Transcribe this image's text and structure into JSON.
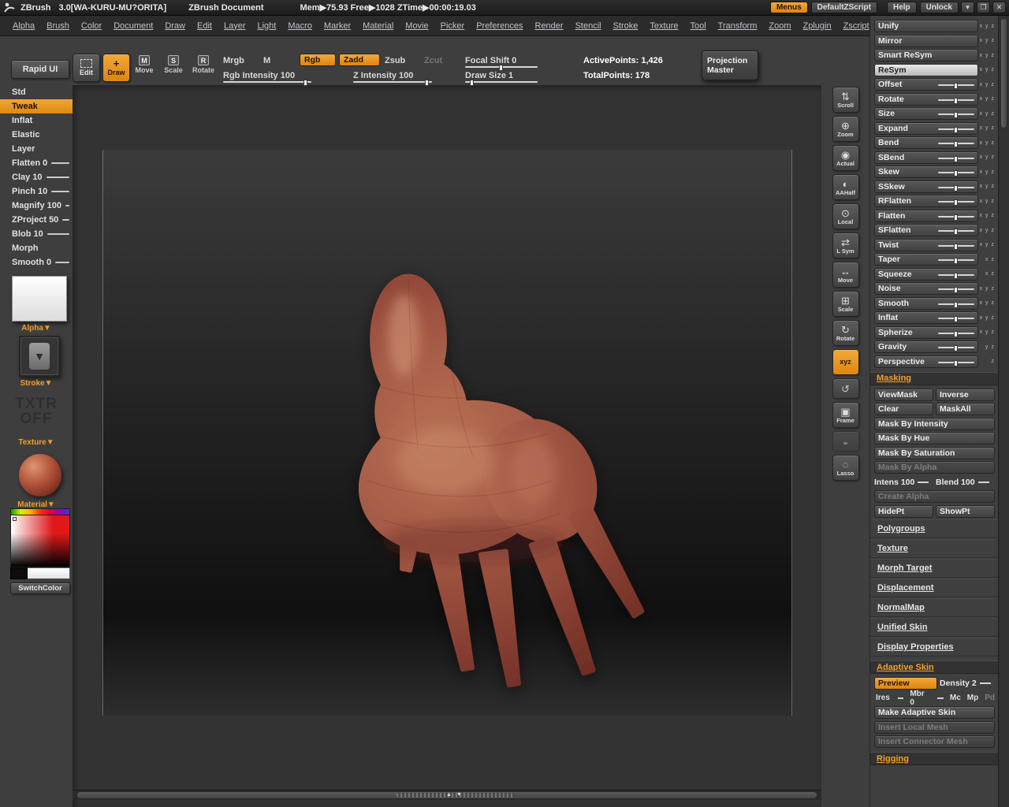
{
  "title_bar": {
    "app": "ZBrush",
    "version": "3.0[WA-KURU-MU?ORITA]",
    "doc_title": "ZBrush Document",
    "stats": "Mem▶75.93  Free▶1028  ZTime▶00:00:19.03",
    "menus": "Menus",
    "default_zscript": "DefaultZScript",
    "help": "Help",
    "unlock": "Unlock",
    "min_glyph": "▾",
    "restore_glyph": "❐",
    "close_glyph": "✕"
  },
  "menu_bar": {
    "items": [
      "Alpha",
      "Brush",
      "Color",
      "Document",
      "Draw",
      "Edit",
      "Layer",
      "Light",
      "Macro",
      "Marker",
      "Material",
      "Movie",
      "Picker",
      "Preferences",
      "Render",
      "Stencil",
      "Stroke",
      "Texture",
      "Tool",
      "Transform",
      "Zoom",
      "Zplugin",
      "Zscript"
    ]
  },
  "toolbar": {
    "rapid_ui": "Rapid UI",
    "edit": "Edit",
    "draw": "Draw",
    "move": "Move",
    "scale": "Scale",
    "rotate": "Rotate",
    "move_icon": "M",
    "scale_icon": "S",
    "rotate_icon": "R",
    "draw_icon": "+",
    "mrgb": "Mrgb",
    "m": "M",
    "rgb": "Rgb",
    "zadd": "Zadd",
    "zsub": "Zsub",
    "zcut": "Zcut",
    "rgb_intensity": "Rgb Intensity 100",
    "z_intensity": "Z Intensity 100",
    "focal_shift": "Focal Shift 0",
    "draw_size": "Draw Size 1",
    "active_points": "ActivePoints: 1,426",
    "total_points": "TotalPoints: 178",
    "projection_master_1": "Projection",
    "projection_master_2": "Master"
  },
  "left_panel": {
    "brushes": [
      "Std",
      "Tweak",
      "Inflat",
      "Elastic",
      "Layer",
      "Flatten 0",
      "Clay 10",
      "Pinch 10",
      "Magnify 100",
      "ZProject 50",
      "Blob 10",
      "Morph",
      "Smooth 0"
    ],
    "alpha_label": "Alpha▼",
    "stroke_label": "Stroke▼",
    "stroke_glyph": "▼",
    "texture_line1": "TXTR",
    "texture_line2": "OFF",
    "texture_label": "Texture▼",
    "material_label": "Material▼",
    "switch_color": "SwitchColor"
  },
  "transform_strip": {
    "items": [
      {
        "label": "Scroll",
        "glyph": "⇅"
      },
      {
        "label": "Zoom",
        "glyph": "⊕"
      },
      {
        "label": "Actual",
        "glyph": "◉"
      },
      {
        "label": "AAHalf",
        "glyph": "◐"
      },
      {
        "label": "Local",
        "glyph": "⊙"
      },
      {
        "label": "L Sym",
        "glyph": "⇄"
      },
      {
        "label": "Move",
        "glyph": "↔"
      },
      {
        "label": "Scale",
        "glyph": "⊞"
      },
      {
        "label": "Rotate",
        "glyph": "↻"
      },
      {
        "label": "xyz",
        "glyph": ""
      },
      {
        "label": "",
        "glyph": "↺"
      },
      {
        "label": "Frame",
        "glyph": "▣"
      },
      {
        "label": "",
        "glyph": "◒"
      },
      {
        "label": "Lasso",
        "glyph": "◌"
      }
    ]
  },
  "deformation": {
    "buttons": [
      {
        "label": "Unify",
        "axes": "x y z"
      },
      {
        "label": "Mirror",
        "axes": "x y z"
      },
      {
        "label": "Smart ReSym",
        "axes": "x y z"
      },
      {
        "label": "ReSym",
        "axes": "x y z"
      }
    ],
    "sliders": [
      {
        "label": "Offset",
        "axes": "x y z"
      },
      {
        "label": "Rotate",
        "axes": "x y z"
      },
      {
        "label": "Size",
        "axes": "x y z"
      },
      {
        "label": "Expand",
        "axes": "x y z"
      },
      {
        "label": "Bend",
        "axes": "x y z"
      },
      {
        "label": "SBend",
        "axes": "x y z"
      },
      {
        "label": "Skew",
        "axes": "x y z"
      },
      {
        "label": "SSkew",
        "axes": "x y z"
      },
      {
        "label": "RFlatten",
        "axes": "x y z"
      },
      {
        "label": "Flatten",
        "axes": "x y z"
      },
      {
        "label": "SFlatten",
        "axes": "x y z"
      },
      {
        "label": "Twist",
        "axes": "x y z"
      },
      {
        "label": "Taper",
        "axes": "x z"
      },
      {
        "label": "Squeeze",
        "axes": "x z"
      },
      {
        "label": "Noise",
        "axes": "x y z"
      },
      {
        "label": "Smooth",
        "axes": "x y z"
      },
      {
        "label": "Inflat",
        "axes": "x y z"
      },
      {
        "label": "Spherize",
        "axes": "x y z"
      },
      {
        "label": "Gravity",
        "axes": "y z"
      },
      {
        "label": "Perspective",
        "axes": "z"
      }
    ]
  },
  "masking": {
    "header": "Masking",
    "viewmask": "ViewMask",
    "inverse": "Inverse",
    "clear": "Clear",
    "maskall": "MaskAll",
    "by_intensity": "Mask By Intensity",
    "by_hue": "Mask By Hue",
    "by_saturation": "Mask By Saturation",
    "by_alpha": "Mask By Alpha",
    "intens": "Intens 100",
    "blend": "Blend 100",
    "create_alpha": "Create Alpha",
    "hidept": "HidePt",
    "showpt": "ShowPt"
  },
  "sections": {
    "links": [
      "Polygroups",
      "Texture",
      "Morph Target",
      "Displacement",
      "NormalMap",
      "Unified Skin",
      "Display Properties"
    ]
  },
  "adaptive_skin": {
    "header": "Adaptive Skin",
    "preview": "Preview",
    "density": "Density 2",
    "ires": "Ires",
    "mbr": "Mbr 0",
    "mc": "Mc",
    "mp": "Mp",
    "pd": "Pd",
    "make": "Make Adaptive Skin",
    "insert_local": "Insert Local Mesh",
    "insert_connector": "Insert Connector Mesh"
  },
  "rigging": {
    "header": "Rigging"
  },
  "canvas": {
    "scroll_arrows": "▲ ▼"
  },
  "colors": {
    "accent_orange": "#e8961e",
    "hand_base": "#a45a45",
    "panel_bg": "#3f3f3f"
  }
}
